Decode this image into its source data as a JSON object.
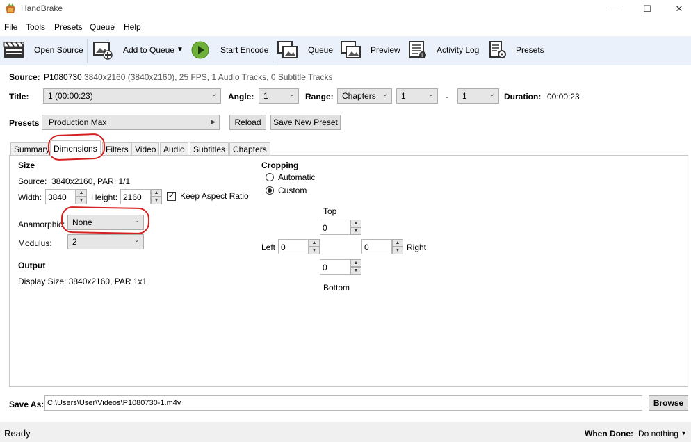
{
  "window": {
    "title": "HandBrake",
    "minimize": "—",
    "maximize": "☐",
    "close": "✕"
  },
  "menu": [
    "File",
    "Tools",
    "Presets",
    "Queue",
    "Help"
  ],
  "toolbar": {
    "open_source": "Open Source",
    "add_to_queue": "Add to Queue",
    "start_encode": "Start Encode",
    "queue": "Queue",
    "preview": "Preview",
    "activity_log": "Activity Log",
    "presets": "Presets"
  },
  "source": {
    "label": "Source:",
    "name": "P1080730",
    "details": "3840x2160 (3840x2160), 25 FPS, 1 Audio Tracks, 0 Subtitle Tracks"
  },
  "title_row": {
    "title_label": "Title:",
    "title_value": "1 (00:00:23)",
    "angle_label": "Angle:",
    "angle_value": "1",
    "range_label": "Range:",
    "range_value": "Chapters",
    "range_start": "1",
    "range_dash": "-",
    "range_end": "1",
    "duration_label": "Duration:",
    "duration_value": "00:00:23"
  },
  "presets_row": {
    "label": "Presets",
    "value": "Production Max",
    "reload": "Reload",
    "save_new": "Save New Preset"
  },
  "tabs": [
    "Summary",
    "Dimensions",
    "Filters",
    "Video",
    "Audio",
    "Subtitles",
    "Chapters"
  ],
  "dimensions": {
    "size_heading": "Size",
    "source_label": "Source:",
    "source_value": "3840x2160, PAR: 1/1",
    "width_label": "Width:",
    "width_value": "3840",
    "height_label": "Height:",
    "height_value": "2160",
    "keep_aspect": "Keep Aspect Ratio",
    "anamorphic_label": "Anamorphic:",
    "anamorphic_value": "None",
    "modulus_label": "Modulus:",
    "modulus_value": "2",
    "output_heading": "Output",
    "display_size": "Display Size: 3840x2160,  PAR 1x1"
  },
  "cropping": {
    "heading": "Cropping",
    "automatic": "Automatic",
    "custom": "Custom",
    "top_label": "Top",
    "top_value": "0",
    "left_label": "Left",
    "left_value": "0",
    "right_label": "Right",
    "right_value": "0",
    "bottom_label": "Bottom",
    "bottom_value": "0"
  },
  "save_as": {
    "label": "Save As:",
    "path": "C:\\Users\\User\\Videos\\P1080730-1.m4v",
    "browse": "Browse"
  },
  "status": {
    "text": "Ready",
    "when_done_label": "When Done:",
    "when_done_value": "Do nothing"
  },
  "colors": {
    "toolbar_bg": "#eaf1fb",
    "annotation": "#d42020",
    "play_green": "#6fb13a"
  }
}
